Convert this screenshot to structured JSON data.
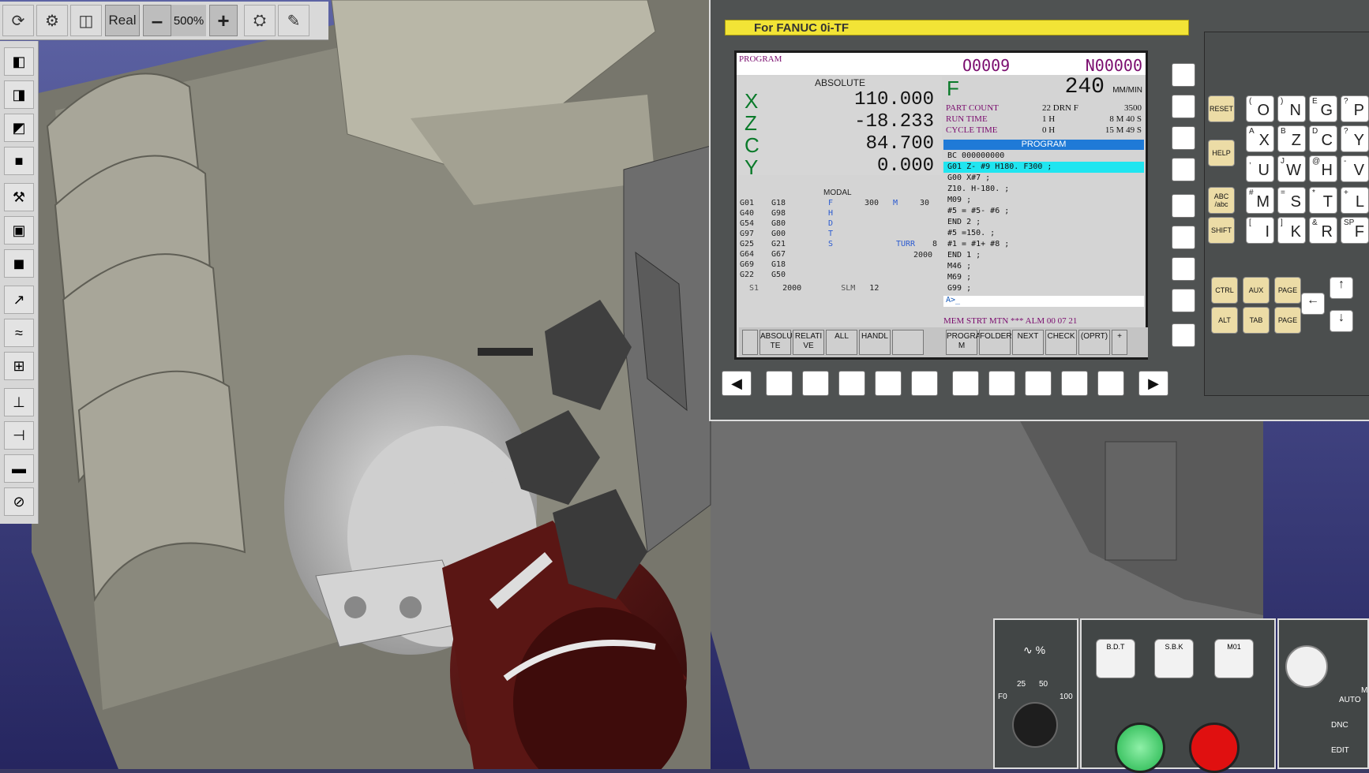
{
  "toolbar": {
    "real_label": "Real",
    "zoom_minus": "–",
    "zoom_value": "500%",
    "zoom_plus": "+"
  },
  "cnc": {
    "title": "For FANUC 0i-TF",
    "screen": {
      "mode_label": "PROGRAM",
      "o_number": "O0009",
      "n_number": "N00000",
      "absolute_title": "ABSOLUTE",
      "axes": [
        {
          "name": "X",
          "value": "110.000"
        },
        {
          "name": "Z",
          "value": "-18.233"
        },
        {
          "name": "C",
          "value": "84.700"
        },
        {
          "name": "Y",
          "value": "0.000"
        }
      ],
      "feed_label": "F",
      "feed_value": "240",
      "feed_unit": "MM/MIN",
      "stats": [
        {
          "label": "PART COUNT",
          "v1": "22 DRN F",
          "v2": "3500"
        },
        {
          "label": "RUN TIME",
          "v1": "1 H",
          "v2": "8 M  40 S"
        },
        {
          "label": "CYCLE TIME",
          "v1": "0 H",
          "v2": "15 M  49 S"
        }
      ],
      "program_header": "PROGRAM",
      "program_lines": [
        "BC 000000000",
        "G01 Z- #9 H180. F300 ;",
        "G00 X#7 ;",
        "Z10. H-180. ;",
        "M09 ;",
        "#5 = #5- #6 ;",
        "END 2 ;",
        "#5 =150. ;",
        "#1 = #1+ #8 ;",
        "END 1 ;",
        "M46 ;",
        "M69 ;",
        "G99 ;"
      ],
      "cmd_prompt": "A>_",
      "status_text": "MEM STRT MTN *** ALM 00 07 21",
      "modal_title": "MODAL",
      "modal_col1": [
        "G01",
        "G40",
        "G54",
        "G97",
        "G25",
        "G64",
        "G69",
        "G22"
      ],
      "modal_col2": [
        "G18",
        "G98",
        "G80",
        "G00",
        "G21",
        "G67",
        "G18",
        "G50"
      ],
      "modal_letters": [
        "F",
        "H",
        "D",
        "T",
        "S"
      ],
      "modal_f_value": "300",
      "modal_m_label": "M",
      "modal_m_value": "30",
      "turr_label": "TURR",
      "turr_value": "8",
      "spindle_value": "2000",
      "s1_label": "S1",
      "s1_value": "2000",
      "slm_label": "SLM",
      "slm_value": "12",
      "softkeys_left": [
        "ABSOLU TE",
        "RELATI VE",
        "ALL",
        "HANDL",
        ""
      ],
      "softkeys_right": [
        "PROGRA M",
        "FOLDER",
        "NEXT",
        "CHECK",
        "(OPRT)",
        "+"
      ]
    },
    "keys": {
      "reset": "RESET",
      "help": "HELP",
      "abc": "ABC /abc",
      "shift": "SHIFT",
      "ctrl": "CTRL",
      "aux": "AUX",
      "alt": "ALT",
      "tab": "TAB",
      "page_up": "PAGE",
      "page_down": "PAGE",
      "letters": [
        {
          "big": "O",
          "small": "("
        },
        {
          "big": "N",
          "small": ")"
        },
        {
          "big": "G",
          "small": "E"
        },
        {
          "big": "P",
          "small": "?"
        },
        {
          "big": "X",
          "small": "A"
        },
        {
          "big": "Z",
          "small": "B"
        },
        {
          "big": "C",
          "small": "D"
        },
        {
          "big": "Y",
          "small": "?"
        },
        {
          "big": "U",
          "small": ","
        },
        {
          "big": "W",
          "small": "J"
        },
        {
          "big": "H",
          "small": "@"
        },
        {
          "big": "V",
          "small": "-"
        },
        {
          "big": "M",
          "small": "#"
        },
        {
          "big": "S",
          "small": "="
        },
        {
          "big": "T",
          "small": "*"
        },
        {
          "big": "L",
          "small": "+"
        },
        {
          "big": "I",
          "small": "["
        },
        {
          "big": "K",
          "small": "]"
        },
        {
          "big": "R",
          "small": "&"
        },
        {
          "big": "F",
          "small": "SP"
        }
      ]
    }
  },
  "operator": {
    "feed_override_icon": "wave-percent-icon",
    "dial_labels": [
      "F0",
      "25",
      "50",
      "100"
    ],
    "bdt": "B.D.T",
    "sbk": "S.B.K",
    "m01": "M01",
    "auto": "AUTO",
    "dnc": "DNC",
    "edit": "EDIT",
    "m_label": "M"
  },
  "colors": {
    "program_purple": "#7a0c6e",
    "axis_green": "#0a7a2a",
    "highlight_cyan": "#20e5f0",
    "header_blue": "#1f7ad7",
    "cycle_start": "#1fb34a",
    "cycle_stop": "#e01010"
  }
}
